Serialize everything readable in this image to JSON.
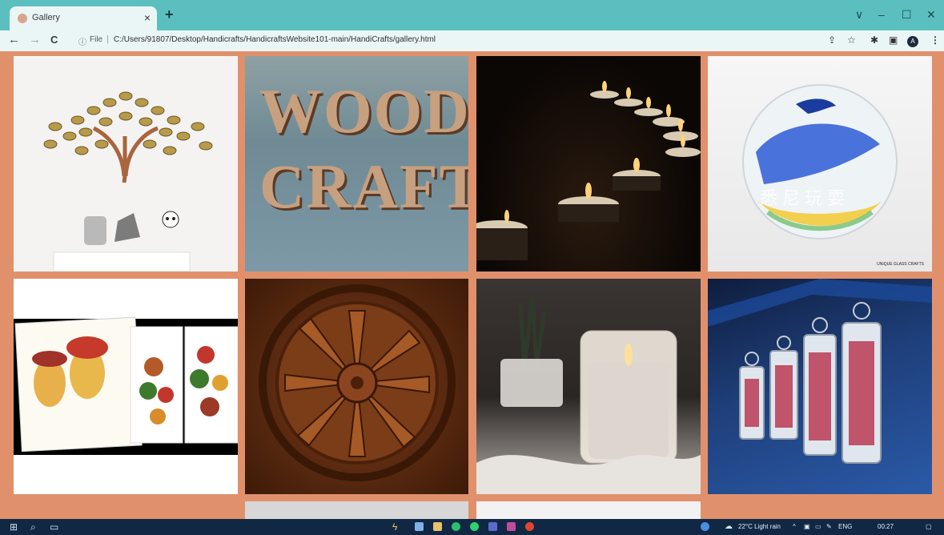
{
  "browser": {
    "tab_title": "Gallery",
    "tab_close": "×",
    "new_tab": "+",
    "window_controls": {
      "collapse": "∨",
      "minimize": "–",
      "maximize": "☐",
      "close": "✕"
    },
    "nav": {
      "back": "←",
      "forward": "→",
      "reload": "C"
    },
    "omnibox": {
      "info_icon": "ⓘ",
      "scheme_label": "File",
      "separator": "|",
      "url": "C:/Users/91807/Desktop/Handicrafts/HandicraftsWebsite101-main/HandiCrafts/gallery.html"
    },
    "toolbar_icons": {
      "share": "⇪",
      "star": "☆",
      "extensions": "✱",
      "side_panel": "▣",
      "menu": "⋮"
    },
    "profile_initial": "A"
  },
  "gallery": {
    "images": [
      {
        "name": "tree-of-life-wall-art"
      },
      {
        "name": "wood-craft-letters",
        "text_line1": "WOOD",
        "text_line2": "CRAFT"
      },
      {
        "name": "tealight-candles"
      },
      {
        "name": "glass-paperweight-orb",
        "overlay_text": "悉尼玩耍",
        "credit": "UNIQUE GLASS CRAFTS"
      },
      {
        "name": "painted-puppet-masks-and-pots"
      },
      {
        "name": "carved-wooden-rosette"
      },
      {
        "name": "candle-in-glass-jar"
      },
      {
        "name": "hanging-metal-lanterns"
      },
      {
        "name": "partial-image-bottom-1"
      },
      {
        "name": "partial-image-bottom-2"
      }
    ]
  },
  "taskbar": {
    "weather": "22°C  Light rain",
    "tray_arrow": "^",
    "language": "ENG",
    "clock": "00:27",
    "colors": {
      "bar": "#102844"
    }
  }
}
